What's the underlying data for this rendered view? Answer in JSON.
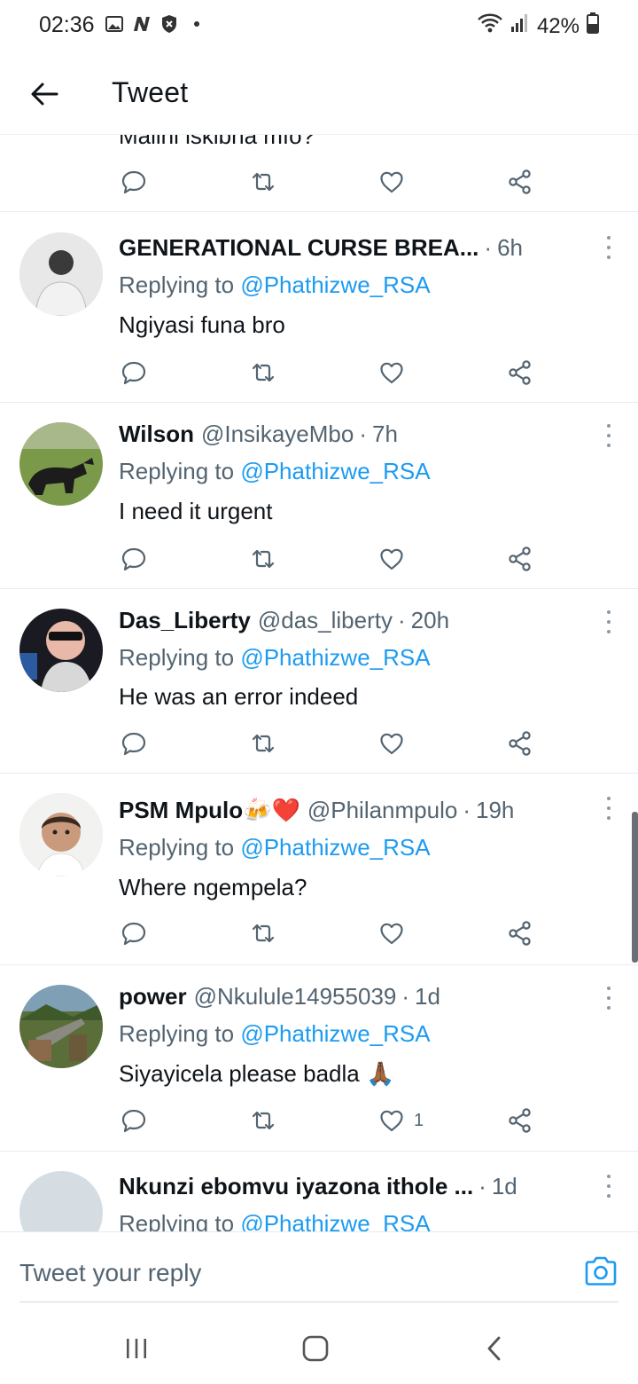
{
  "status_bar": {
    "time": "02:36",
    "battery": "42%"
  },
  "header": {
    "title": "Tweet"
  },
  "partial_tweet": {
    "text": "Malini iskibha mfo?"
  },
  "tweets": [
    {
      "name": "GENERATIONAL CURSE BREA...",
      "handle": "",
      "time": "6h",
      "replying_label": "Replying to",
      "mention": "@Phathizwe_RSA",
      "text": "Ngiyasi funa bro",
      "likes": ""
    },
    {
      "name": "Wilson",
      "handle": "@InsikayeMbo",
      "time": "7h",
      "replying_label": "Replying to",
      "mention": "@Phathizwe_RSA",
      "text": "I need it urgent",
      "likes": ""
    },
    {
      "name": "Das_Liberty",
      "handle": "@das_liberty",
      "time": "20h",
      "replying_label": "Replying to",
      "mention": "@Phathizwe_RSA",
      "text": "He was an error indeed",
      "likes": ""
    },
    {
      "name": "PSM Mpulo🍻❤️",
      "handle": "@Philanmpulo",
      "time": "19h",
      "replying_label": "Replying to",
      "mention": "@Phathizwe_RSA",
      "text": "Where ngempela?",
      "likes": ""
    },
    {
      "name": "power",
      "handle": "@Nkulule14955039",
      "time": "1d",
      "replying_label": "Replying to",
      "mention": "@Phathizwe_RSA",
      "text": "Siyayicela please badla 🙏🏾",
      "likes": "1"
    },
    {
      "name": "Nkunzi ebomvu iyazona ithole ...",
      "handle": "",
      "time": "1d",
      "replying_label": "Replying to",
      "mention": "@Phathizwe_RSA",
      "text": "",
      "likes": ""
    }
  ],
  "reply_bar": {
    "placeholder": "Tweet your reply"
  },
  "icons": {
    "reply": "reply-icon",
    "retweet": "retweet-icon",
    "like": "heart-icon",
    "share": "share-icon",
    "camera": "camera-icon",
    "back": "arrow-left-icon",
    "more": "more-vertical-icon"
  },
  "colors": {
    "accent": "#1d9bf0",
    "muted": "#536471",
    "text": "#0f1419",
    "divider": "#e6ecf0"
  }
}
